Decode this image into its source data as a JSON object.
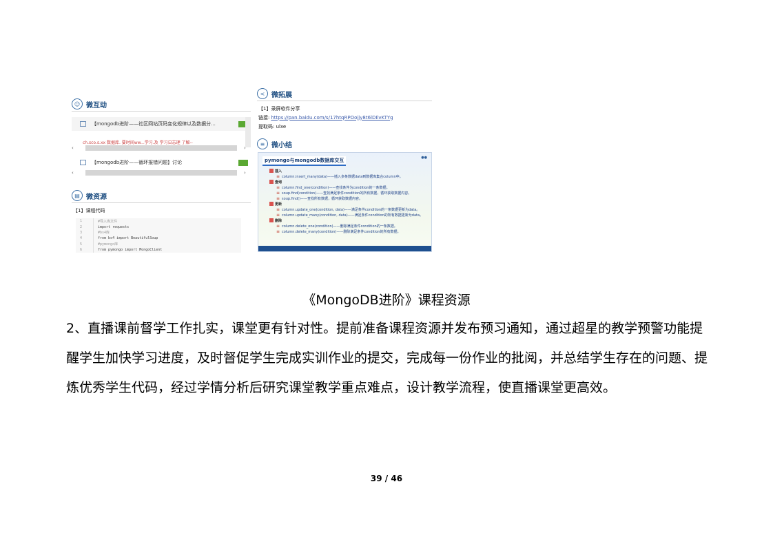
{
  "figure": {
    "interact": {
      "title": "微互动",
      "items": [
        {
          "text": "【mongodb进阶——社区网站页码变化规律以及数据分...",
          "badge": "",
          "faded_after": "ch.sco.s.xx    数据库. 要时间ww...学习.及 学习日志理 了解-- "
        },
        {
          "text": "【mongodb进阶——循环报错问题】讨论",
          "badge": ""
        }
      ]
    },
    "resource": {
      "title": "微资源",
      "label": "【1】课程代码",
      "code": [
        {
          "ln": "1",
          "text": "#导入库文件"
        },
        {
          "ln": "2",
          "text": "import requests"
        },
        {
          "ln": "3",
          "text": "#bs4库"
        },
        {
          "ln": "4",
          "text": "from bs4 import BeautifulSoup"
        },
        {
          "ln": "5",
          "text": "#pymongo库"
        },
        {
          "ln": "6",
          "text": "from pymongo import MongoClient"
        }
      ]
    },
    "extend": {
      "title": "微拓展",
      "item": "【1】录屏软件分享",
      "link_label": "链接:",
      "link_url": "https://pan.baidu.com/s/17htqRPOojjy8t6lDIlvKTYg",
      "code_label": "提取码: ulxe"
    },
    "summary": {
      "title": "微小结",
      "image_title": "pymongo与mongodb数据库交互",
      "sections": [
        {
          "name": "插入",
          "items": [
            "column.insert_many(data)——插入多条数据data到数据库集合column中。"
          ]
        },
        {
          "name": "查询",
          "items": [
            "column.find_one(condition)——查找条件为condition的一条数据。",
            "soup.find(condition)——查找满足条件condition的所有数据，循环获取数据内容。",
            "soup.find()——查找所有数据，循环获取数据内容。"
          ]
        },
        {
          "name": "更新",
          "items": [
            "column.update_one(condition, data)——满足条件condition的一条数据更新为data。",
            "column.update_many(condition, data)——满足条件condition的所有数据更新为data。"
          ]
        },
        {
          "name": "删除",
          "items": [
            "column.delete_one(condition)——删除满足条件condition的一条数据。",
            "column.delete_many(condition)——删除满足条件condition的所有数据。"
          ]
        }
      ]
    }
  },
  "caption": "《MongoDB进阶》课程资源",
  "paragraph": "2、直播课前督学工作扎实，课堂更有针对性。提前准备课程资源并发布预习通知，通过超星的教学预警功能提醒学生加快学习进度，及时督促学生完成实训作业的提交，完成每一份作业的批阅，并总结学生存在的问题、提炼优秀学生代码，经过学情分析后研究课堂教学重点难点，设计教学流程，使直播课堂更高效。",
  "page_number": "39 / 46"
}
